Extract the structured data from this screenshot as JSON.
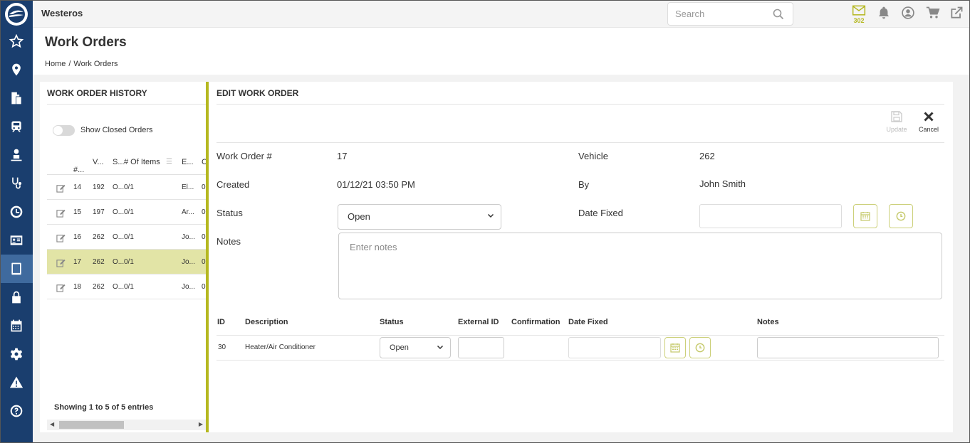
{
  "app": {
    "name": "Westeros"
  },
  "search": {
    "placeholder": "Search"
  },
  "topbar": {
    "mail_count": "302"
  },
  "sidebar": {
    "items": [
      {
        "icon": "star-icon"
      },
      {
        "icon": "map-pin-icon"
      },
      {
        "icon": "documents-icon"
      },
      {
        "icon": "train-icon"
      },
      {
        "icon": "driver-icon"
      },
      {
        "icon": "stethoscope-icon"
      },
      {
        "icon": "clock-icon"
      },
      {
        "icon": "id-card-icon"
      },
      {
        "icon": "tablet-icon",
        "active": true
      },
      {
        "icon": "lock-icon"
      },
      {
        "icon": "calendar-icon"
      },
      {
        "icon": "gear-icon"
      },
      {
        "icon": "warning-icon"
      },
      {
        "icon": "help-icon"
      }
    ]
  },
  "page": {
    "title": "Work Orders",
    "breadcrumb": {
      "home": "Home",
      "separator": "/",
      "current": "Work Orders"
    }
  },
  "history": {
    "title": "WORK ORDER HISTORY",
    "toggle_label": "Show Closed Orders",
    "columns": [
      "#...",
      "V...",
      "S...",
      "# Of Items",
      "E...",
      "C"
    ],
    "rows": [
      {
        "num": "14",
        "vehicle": "192",
        "status": "O...",
        "items": "0/1",
        "by": "El...",
        "c": "0"
      },
      {
        "num": "15",
        "vehicle": "197",
        "status": "O...",
        "items": "0/1",
        "by": "Ar...",
        "c": "0"
      },
      {
        "num": "16",
        "vehicle": "262",
        "status": "O...",
        "items": "0/1",
        "by": "Jo...",
        "c": "0"
      },
      {
        "num": "17",
        "vehicle": "262",
        "status": "O...",
        "items": "0/1",
        "by": "Jo...",
        "c": "0",
        "selected": true
      },
      {
        "num": "18",
        "vehicle": "262",
        "status": "O...",
        "items": "0/1",
        "by": "Jo...",
        "c": "0"
      }
    ],
    "showing": "Showing 1 to 5 of 5 entries"
  },
  "edit": {
    "title": "EDIT WORK ORDER",
    "update_label": "Update",
    "cancel_label": "Cancel",
    "work_order_label": "Work Order #",
    "work_order_value": "17",
    "vehicle_label": "Vehicle",
    "vehicle_value": "262",
    "created_label": "Created",
    "created_value": "01/12/21 03:50 PM",
    "by_label": "By",
    "by_value": "John Smith",
    "status_label": "Status",
    "status_value": "Open",
    "date_fixed_label": "Date Fixed",
    "date_fixed_value": "",
    "notes_label": "Notes",
    "notes_placeholder": "Enter notes"
  },
  "items": {
    "headers": [
      "ID",
      "Description",
      "Status",
      "External ID",
      "Confirmation",
      "Date Fixed",
      "Notes"
    ],
    "rows": [
      {
        "id": "30",
        "description": "Heater/Air Conditioner",
        "status": "Open",
        "external_id": "",
        "confirmation": "",
        "date_fixed": "",
        "notes": ""
      }
    ]
  },
  "colors": {
    "accent": "#b5b820",
    "sidebar": "#1a3e6e",
    "selected_row": "#e2e4a6"
  }
}
